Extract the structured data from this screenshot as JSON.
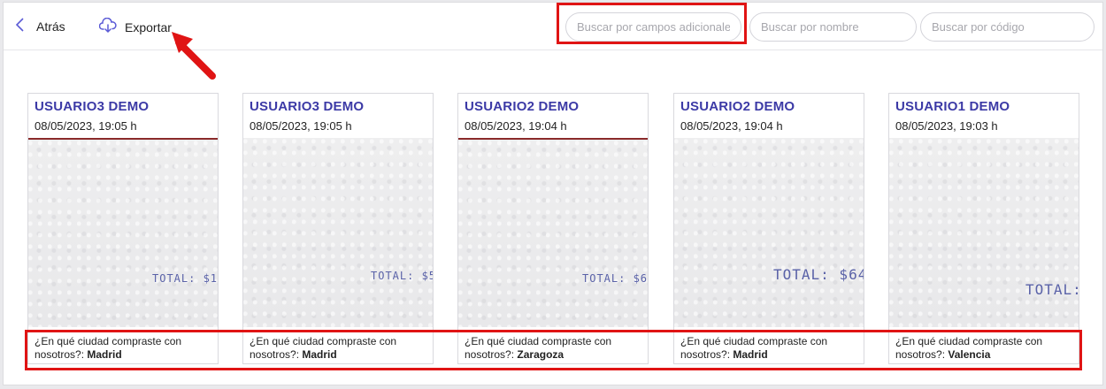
{
  "toolbar": {
    "back_label": "Atrás",
    "export_label": "Exportar"
  },
  "search": {
    "extra_fields_placeholder": "Buscar por campos adicionales",
    "name_placeholder": "Buscar por nombre",
    "code_placeholder": "Buscar por código"
  },
  "cards": [
    {
      "name": "USUARIO3 DEMO",
      "date": "08/05/2023, 19:05 h",
      "receipt_total": "TOTAL: $1",
      "question": "¿En qué ciudad compraste con nosotros?:",
      "answer": "Madrid"
    },
    {
      "name": "USUARIO3 DEMO",
      "date": "08/05/2023, 19:05 h",
      "receipt_total": "TOTAL: $5",
      "question": "¿En qué ciudad compraste con nosotros?:",
      "answer": "Madrid"
    },
    {
      "name": "USUARIO2 DEMO",
      "date": "08/05/2023, 19:04 h",
      "receipt_total": "TOTAL: $6",
      "question": "¿En qué ciudad compraste con nosotros?:",
      "answer": "Zaragoza"
    },
    {
      "name": "USUARIO2 DEMO",
      "date": "08/05/2023, 19:04 h",
      "receipt_total": "TOTAL: $64",
      "question": "¿En qué ciudad compraste con nosotros?:",
      "answer": "Madrid"
    },
    {
      "name": "USUARIO1 DEMO",
      "date": "08/05/2023, 19:03 h",
      "receipt_total": "TOTAL:",
      "question": "¿En qué ciudad compraste con nosotros?:",
      "answer": "Valencia"
    }
  ],
  "icons": {
    "back": "chevron-left-icon",
    "export": "cloud-download-icon"
  },
  "colors": {
    "accent": "#3c3aa6",
    "highlight": "#e01414"
  }
}
